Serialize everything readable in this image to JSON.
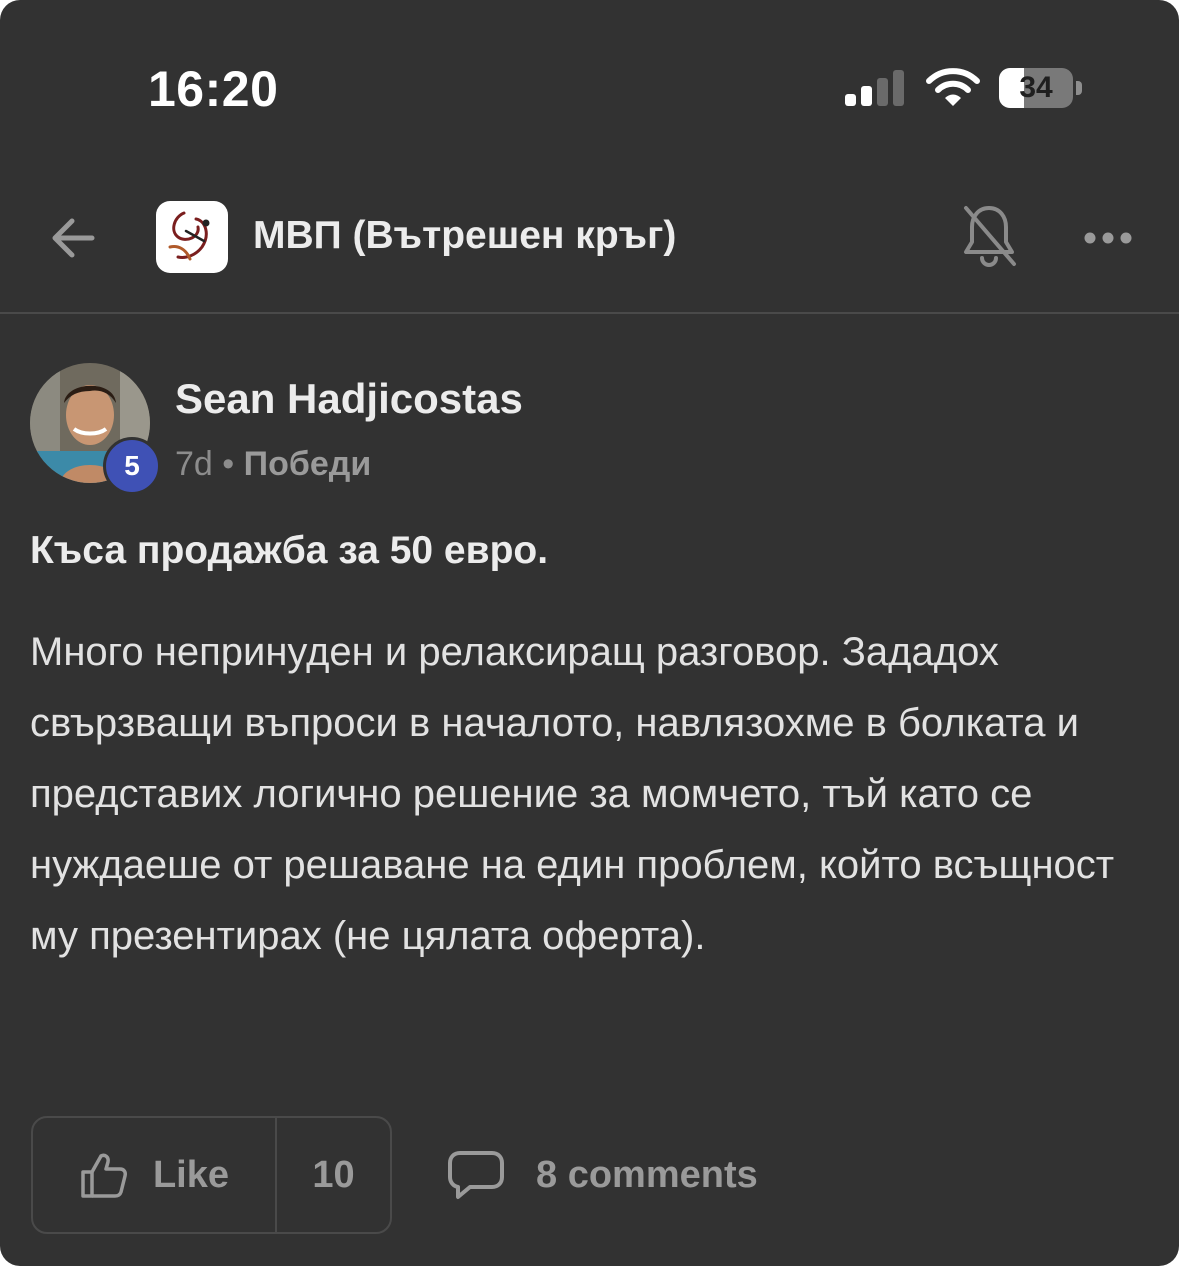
{
  "status_bar": {
    "time": "16:20",
    "battery_percent": "34",
    "battery_level": 0.34,
    "signal_bars_active": 2,
    "signal_icon": "cellular-signal-icon",
    "wifi_icon": "wifi-icon",
    "battery_icon": "battery-icon"
  },
  "header": {
    "back_icon": "arrow-left-icon",
    "group_name": "МВП (Вътрешен кръг)",
    "notifications_icon": "bell-off-icon",
    "more_icon": "more-horizontal-icon"
  },
  "post": {
    "author": "Sean Hadjicostas",
    "level": "5",
    "age": "7d",
    "separator": "•",
    "category": "Победи",
    "title": "Къса продажба за 50 евро.",
    "body": "Много непринуден и релаксиращ разговор. Зададох свързващи въпроси в началото, навлязохме в болката и представих логично решение за момчето, тъй като се нуждаеше от решаване на един проблем, който всъщност му презентирах (не цялата оферта)."
  },
  "actions": {
    "like_label": "Like",
    "like_count": "10",
    "like_icon": "thumbs-up-icon",
    "comments_label": "8 comments",
    "comments_icon": "chat-bubble-icon"
  },
  "colors": {
    "background": "#323232",
    "text": "#ececec",
    "muted": "#9a9a9a",
    "badge": "#3f51b5",
    "divider": "#4a4a4a"
  }
}
